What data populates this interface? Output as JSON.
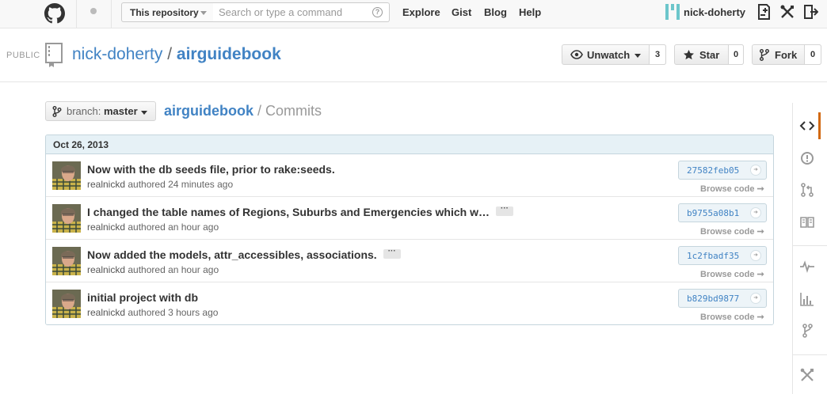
{
  "header": {
    "scope_label": "This repository",
    "search_placeholder": "Search or type a command",
    "nav": [
      "Explore",
      "Gist",
      "Blog",
      "Help"
    ],
    "username": "nick-doherty"
  },
  "repo": {
    "visibility": "PUBLIC",
    "owner": "nick-doherty",
    "separator": "/",
    "name": "airguidebook",
    "unwatch_label": "Unwatch",
    "unwatch_count": "3",
    "star_label": "Star",
    "star_count": "0",
    "fork_label": "Fork",
    "fork_count": "0"
  },
  "branch": {
    "prefix": "branch:",
    "name": "master"
  },
  "page": {
    "repo": "airguidebook",
    "section": " / Commits"
  },
  "commits": {
    "date": "Oct 26, 2013",
    "browse_label": "Browse code",
    "items": [
      {
        "title": "Now with the db seeds file, prior to rake:seeds.",
        "author": "realnickd",
        "meta": " authored 24 minutes ago",
        "sha": "27582feb05",
        "truncated": false
      },
      {
        "title": "I changed the table names of Regions, Suburbs and Emergencies which w…",
        "author": "realnickd",
        "meta": " authored an hour ago",
        "sha": "b9755a08b1",
        "truncated": true
      },
      {
        "title": "Now added the models, attr_accessibles, associations.",
        "author": "realnickd",
        "meta": " authored an hour ago",
        "sha": "1c2fbadf35",
        "truncated": true
      },
      {
        "title": "initial project with db",
        "author": "realnickd",
        "meta": " authored 3 hours ago",
        "sha": "b829bd9877",
        "truncated": false
      }
    ]
  },
  "colors": {
    "link": "#4183c4",
    "active_tab": "#d26911",
    "group_header_bg": "#e6f1f6"
  },
  "sidebar_icons": [
    "code-icon",
    "issues-icon",
    "pull-requests-icon",
    "wiki-icon",
    "pulse-icon",
    "graphs-icon",
    "network-icon",
    "settings-icon"
  ]
}
